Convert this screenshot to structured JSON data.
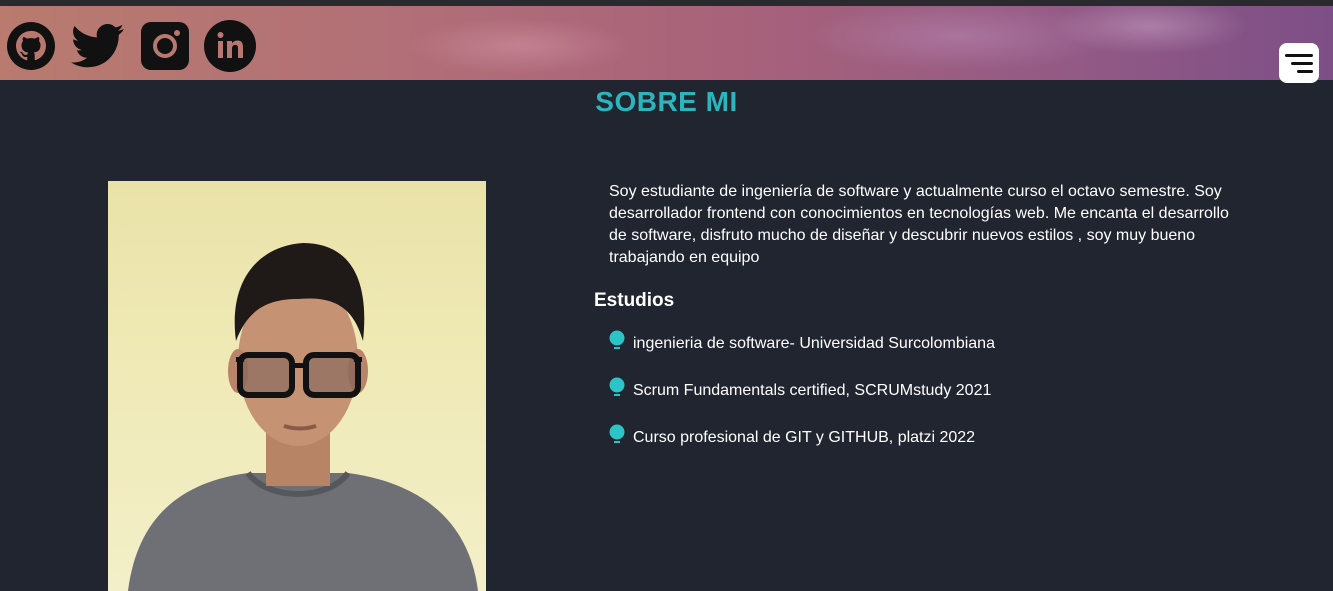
{
  "header": {
    "social_icons": [
      "github-icon",
      "twitter-icon",
      "instagram-icon",
      "linkedin-icon"
    ],
    "menu_icon": "menu-icon"
  },
  "about": {
    "title": "SOBRE MI",
    "intro": "Soy estudiante de ingeniería de software y actualmente curso el octavo semestre. Soy desarrollador frontend con conocimientos en tecnologías web. Me encanta el desarrollo de software, disfruto mucho de diseñar y descubrir nuevos estilos , soy muy bueno trabajando en equipo",
    "studies_title": "Estudios",
    "studies": [
      "ingenieria de software- Universidad Surcolombiana",
      "Scrum Fundamentals certified, SCRUMstudy 2021",
      "Curso profesional de GIT y GITHUB, platzi 2022"
    ]
  },
  "colors": {
    "background": "#20252f",
    "accent": "#2bb5bd",
    "text": "#ffffff"
  }
}
